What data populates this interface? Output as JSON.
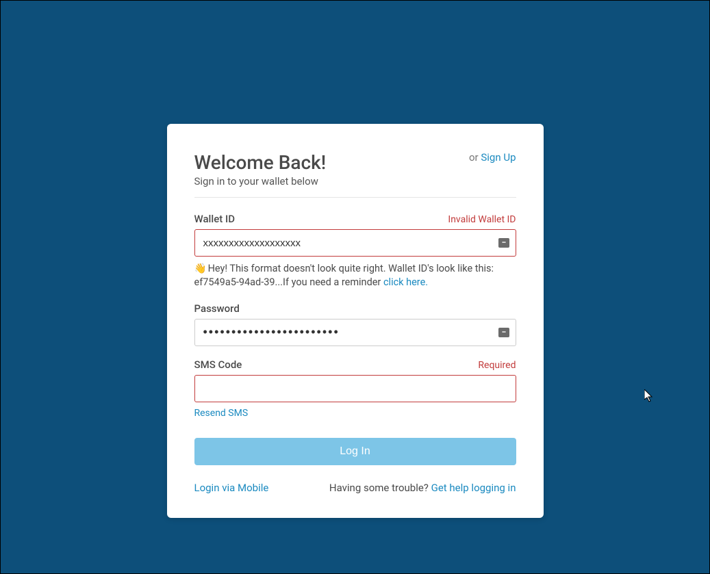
{
  "header": {
    "title": "Welcome Back!",
    "subtitle": "Sign in to your wallet below",
    "or": "or",
    "signup": "Sign Up"
  },
  "wallet": {
    "label": "Wallet ID",
    "error": "Invalid Wallet ID",
    "value": "xxxxxxxxxxxxxxxxxxx",
    "hint_prefix": "Hey! This format doesn't look quite right. Wallet ID's look like this: ef7549a5-94ad-39...If you need a reminder ",
    "hint_link": "click here.",
    "hint_emoji": "👋"
  },
  "password": {
    "label": "Password",
    "value": "••••••••••••••••••••••••"
  },
  "sms": {
    "label": "SMS Code",
    "error": "Required",
    "value": "",
    "resend": "Resend SMS"
  },
  "login_button": "Log In",
  "footer": {
    "mobile": "Login via Mobile",
    "trouble": "Having some trouble?",
    "help": "Get help logging in"
  }
}
